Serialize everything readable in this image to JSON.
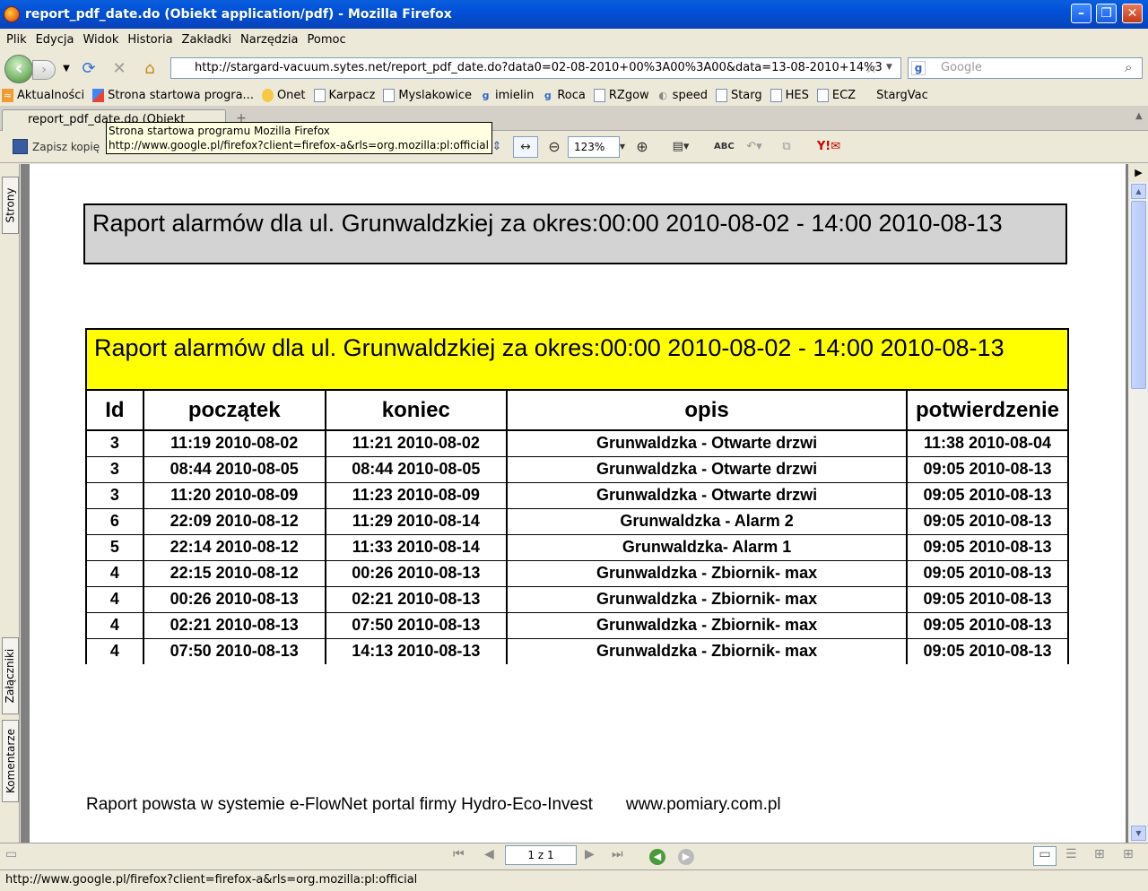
{
  "window": {
    "title": "report_pdf_date.do (Obiekt application/pdf) - Mozilla Firefox"
  },
  "menu": [
    "Plik",
    "Edycja",
    "Widok",
    "Historia",
    "Zakładki",
    "Narzędzia",
    "Pomoc"
  ],
  "nav": {
    "url": "http://stargard-vacuum.sytes.net/report_pdf_date.do?data0=02-08-2010+00%3A00%3A00&data=13-08-2010+14%3",
    "search_placeholder": "Google"
  },
  "bookmarks": [
    "Aktualności",
    "Strona startowa progra...",
    "Onet",
    "Karpacz",
    "Myslakowice",
    "imielin",
    "Roca",
    "RZgow",
    "speed",
    "Starg",
    "HES",
    "ECZ",
    "StargVac"
  ],
  "tab": {
    "label": "report_pdf_date.do (Obiekt"
  },
  "pdf_toolbar": {
    "save_label": "Zapisz kopię",
    "zoom": "123%"
  },
  "tooltip": {
    "line1": "Strona startowa programu Mozilla Firefox",
    "line2": "http://www.google.pl/firefox?client=firefox-a&rls=org.mozilla:pl:official"
  },
  "side_tabs": {
    "pages": "Strony",
    "attachments": "Załączniki",
    "comments": "Komentarze"
  },
  "report": {
    "heading1": "Raport alarmów dla ul. Grunwaldzkiej za okres:00:00 2010-08-02 - 14:00 2010-08-13",
    "heading2": "Raport alarmów dla ul. Grunwaldzkiej za okres:00:00 2010-08-02 - 14:00 2010-08-13",
    "columns": [
      "Id",
      "początek",
      "koniec",
      "opis",
      "potwierdzenie"
    ],
    "rows": [
      [
        "3",
        "11:19 2010-08-02",
        "11:21 2010-08-02",
        "Grunwaldzka - Otwarte drzwi",
        "11:38 2010-08-04"
      ],
      [
        "3",
        "08:44 2010-08-05",
        "08:44 2010-08-05",
        "Grunwaldzka - Otwarte drzwi",
        "09:05 2010-08-13"
      ],
      [
        "3",
        "11:20 2010-08-09",
        "11:23 2010-08-09",
        "Grunwaldzka - Otwarte drzwi",
        "09:05 2010-08-13"
      ],
      [
        "6",
        "22:09 2010-08-12",
        "11:29 2010-08-14",
        "Grunwaldzka - Alarm 2",
        "09:05 2010-08-13"
      ],
      [
        "5",
        "22:14 2010-08-12",
        "11:33 2010-08-14",
        "Grunwaldzka- Alarm 1",
        "09:05 2010-08-13"
      ],
      [
        "4",
        "22:15 2010-08-12",
        "00:26 2010-08-13",
        "Grunwaldzka - Zbiornik- max",
        "09:05 2010-08-13"
      ],
      [
        "4",
        "00:26 2010-08-13",
        "02:21 2010-08-13",
        "Grunwaldzka - Zbiornik- max",
        "09:05 2010-08-13"
      ],
      [
        "4",
        "02:21 2010-08-13",
        "07:50 2010-08-13",
        "Grunwaldzka - Zbiornik- max",
        "09:05 2010-08-13"
      ],
      [
        "4",
        "07:50 2010-08-13",
        "14:13 2010-08-13",
        "Grunwaldzka - Zbiornik- max",
        "09:05 2010-08-13"
      ]
    ],
    "footer_text": "Raport powsta w systemie e-FlowNet portal firmy Hydro-Eco-Invest",
    "footer_url": "www.pomiary.com.pl"
  },
  "pager": {
    "page_label": "1 z 1"
  },
  "status": {
    "text": "http://www.google.pl/firefox?client=firefox-a&rls=org.mozilla:pl:official"
  }
}
